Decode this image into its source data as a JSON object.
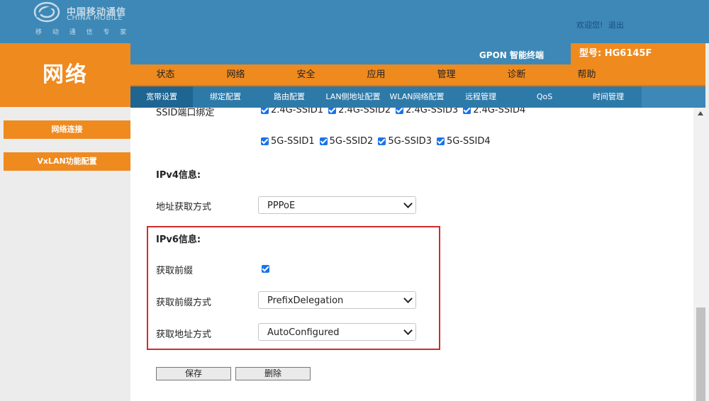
{
  "header": {
    "logo_cn": "中国移动通信",
    "logo_en": "CHINA MOBILE",
    "logo_slogan": "移 动 通 信 专 家",
    "welcome": "欢迎您!",
    "logout": "退出"
  },
  "left": {
    "title": "网络",
    "items": [
      {
        "label": "网络连接"
      },
      {
        "label": "VxLAN功能配置"
      }
    ]
  },
  "top": {
    "product": "GPON 智能终端",
    "model": "型号: HG6145F"
  },
  "main_nav": [
    {
      "label": "状态"
    },
    {
      "label": "网络"
    },
    {
      "label": "安全"
    },
    {
      "label": "应用"
    },
    {
      "label": "管理"
    },
    {
      "label": "诊断"
    },
    {
      "label": "帮助"
    }
  ],
  "sub_nav": [
    {
      "label": "宽带设置",
      "active": true
    },
    {
      "label": "绑定配置"
    },
    {
      "label": "路由配置"
    },
    {
      "label": "LAN侧地址配置"
    },
    {
      "label": "WLAN网络配置"
    },
    {
      "label": "远程管理"
    },
    {
      "label": "QoS"
    },
    {
      "label": "时间管理"
    }
  ],
  "form": {
    "ssid_bind_label": "SSID端口绑定",
    "ssid_24": [
      "2.4G-SSID1",
      "2.4G-SSID2",
      "2.4G-SSID3",
      "2.4G-SSID4"
    ],
    "ssid_5": [
      "5G-SSID1",
      "5G-SSID2",
      "5G-SSID3",
      "5G-SSID4"
    ],
    "ipv4_head": "IPv4信息:",
    "addr_method_label": "地址获取方式",
    "addr_method_value": "PPPoE",
    "ipv6_head": "IPv6信息:",
    "prefix_label": "获取前缀",
    "prefix_checked": true,
    "prefix_method_label": "获取前缀方式",
    "prefix_method_value": "PrefixDelegation",
    "addr6_method_label": "获取地址方式",
    "addr6_method_value": "AutoConfigured"
  },
  "buttons": {
    "save": "保存",
    "delete": "删除"
  },
  "colors": {
    "header_blue": "#3d88b6",
    "orange": "#ef8a1f",
    "highlight_red": "#d32a2a",
    "checkbox_blue": "#1a73e8"
  }
}
